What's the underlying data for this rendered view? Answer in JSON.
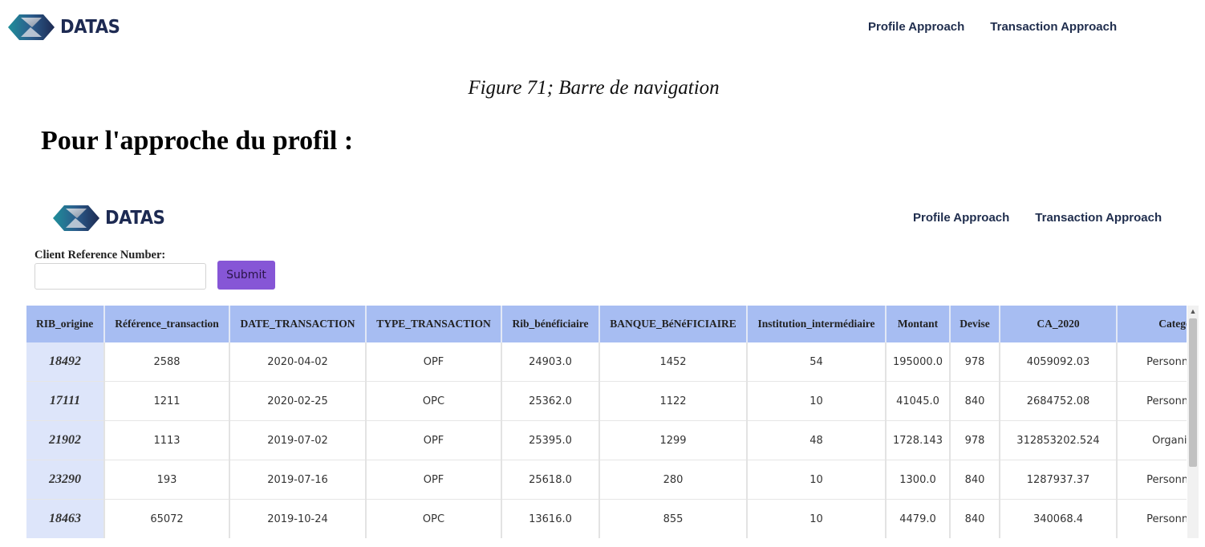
{
  "brand": {
    "name": "DATAS"
  },
  "nav": {
    "links": [
      "Profile Approach",
      "Transaction Approach"
    ]
  },
  "caption": "Figure 71; Barre de navigation",
  "section_heading": "Pour l'approche du profil :",
  "form": {
    "label": "Client Reference Number:",
    "input_value": "",
    "submit_label": "Submit",
    "submit_color": "#8656d6"
  },
  "table": {
    "columns": [
      "RIB_origine",
      "Référence_transaction",
      "DATE_TRANSACTION",
      "TYPE_TRANSACTION",
      "Rib_bénéficiaire",
      "BANQUE_BéNéFICIAIRE",
      "Institution_intermédiaire",
      "Montant",
      "Devise",
      "CA_2020",
      "Categor"
    ],
    "rows": [
      [
        "18492",
        "2588",
        "2020-04-02",
        "OPF",
        "24903.0",
        "1452",
        "54",
        "195000.0",
        "978",
        "4059092.03",
        "Personne m"
      ],
      [
        "17111",
        "1211",
        "2020-02-25",
        "OPC",
        "25362.0",
        "1122",
        "10",
        "41045.0",
        "840",
        "2684752.08",
        "Personne m"
      ],
      [
        "21902",
        "1113",
        "2019-07-02",
        "OPF",
        "25395.0",
        "1299",
        "48",
        "1728.143",
        "978",
        "312853202.524",
        "Organism"
      ],
      [
        "23290",
        "193",
        "2019-07-16",
        "OPF",
        "25618.0",
        "280",
        "10",
        "1300.0",
        "840",
        "1287937.37",
        "Personne m"
      ],
      [
        "18463",
        "65072",
        "2019-10-24",
        "OPC",
        "13616.0",
        "855",
        "10",
        "4479.0",
        "840",
        "340068.4",
        "Personne m"
      ]
    ]
  },
  "colors": {
    "header_bg": "#a7bdf2",
    "first_col_bg": "#dde5fa",
    "brand_text": "#1d2a52"
  },
  "icons": {
    "logo": "datas-logo-icon",
    "scroll_up": "scroll-up-arrow-icon"
  }
}
